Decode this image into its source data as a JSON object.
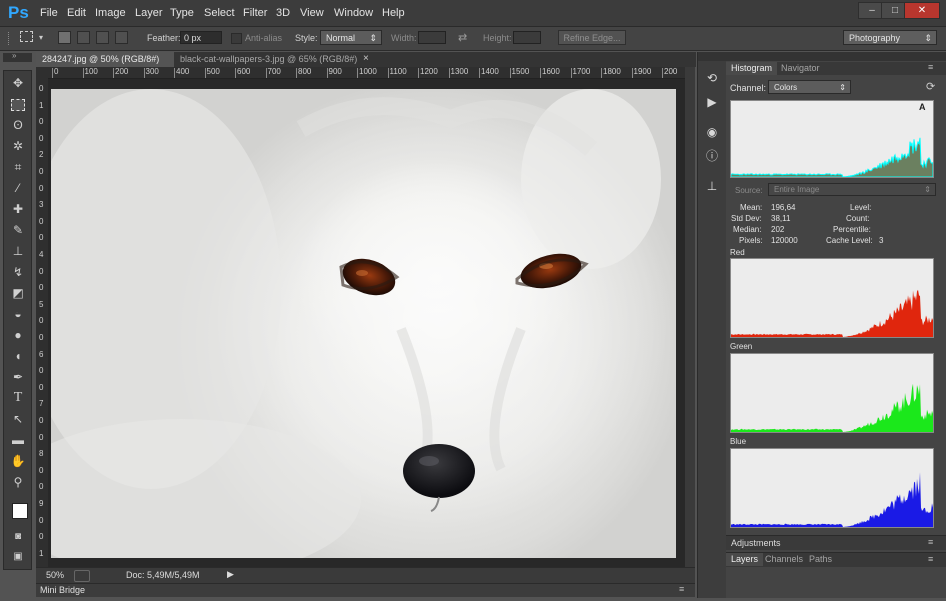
{
  "app": {
    "logo": "Ps"
  },
  "menu": [
    "File",
    "Edit",
    "Image",
    "Layer",
    "Type",
    "Select",
    "Filter",
    "3D",
    "View",
    "Window",
    "Help"
  ],
  "window_controls": {
    "minimize": "–",
    "maximize": "□",
    "close": "✕"
  },
  "options_bar": {
    "feather_label": "Feather:",
    "feather_value": "0 px",
    "antialias_label": "Anti-alias",
    "style_label": "Style:",
    "style_value": "Normal",
    "width_label": "Width:",
    "height_label": "Height:",
    "refine_edge": "Refine Edge...",
    "workspace": "Photography"
  },
  "documents": {
    "tabs": [
      {
        "label": "284247.jpg @ 50% (RGB/8#)",
        "close": "×",
        "active": true
      },
      {
        "label": "black-cat-wallpapers-3.jpg @ 65% (RGB/8#)",
        "close": "×",
        "active": false
      }
    ]
  },
  "ruler": {
    "h_labels": [
      "0",
      "100",
      "200",
      "300",
      "400",
      "500",
      "600",
      "700",
      "800",
      "900",
      "1000",
      "1100",
      "1200",
      "1300",
      "1400",
      "1500",
      "1600",
      "1700",
      "1800",
      "1900",
      "200"
    ],
    "v_labels": [
      "0",
      "1",
      "0",
      "0",
      "2",
      "0",
      "0",
      "3",
      "0",
      "0",
      "4",
      "0",
      "0",
      "5",
      "0",
      "0",
      "6",
      "0",
      "0",
      "7",
      "0",
      "0",
      "8",
      "0",
      "0",
      "9",
      "0",
      "0",
      "1"
    ]
  },
  "status": {
    "zoom": "50%",
    "doc": "Doc: 5,49M/5,49M"
  },
  "mini_bridge": "Mini Bridge",
  "histogram_panel": {
    "tabs": [
      {
        "label": "Histogram",
        "active": true
      },
      {
        "label": "Navigator",
        "active": false
      }
    ],
    "channel_label": "Channel:",
    "channel_value": "Colors",
    "source_label": "Source:",
    "source_value": "Entire Image",
    "stats": {
      "mean_label": "Mean:",
      "mean": "196,64",
      "std_label": "Std Dev:",
      "std": "38,11",
      "median_label": "Median:",
      "median": "202",
      "pixels_label": "Pixels:",
      "pixels": "120000",
      "level_label": "Level:",
      "count_label": "Count:",
      "percentile_label": "Percentile:",
      "cache_label": "Cache Level:",
      "cache": "3"
    },
    "channels": [
      {
        "name": "Red",
        "color": "#e0260d"
      },
      {
        "name": "Green",
        "color": "#1be81b"
      },
      {
        "name": "Blue",
        "color": "#1a1ae6"
      }
    ],
    "warning_icon": "A",
    "colors": {
      "composite_fill": "#6b8060",
      "composite_edge": "#00ffff"
    }
  },
  "adjustments": {
    "label": "Adjustments"
  },
  "layers_panel": {
    "tabs": [
      {
        "label": "Layers",
        "active": true
      },
      {
        "label": "Channels",
        "active": false
      },
      {
        "label": "Paths",
        "active": false
      }
    ]
  }
}
